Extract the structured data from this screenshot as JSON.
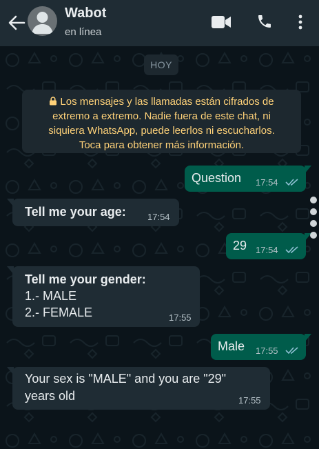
{
  "header": {
    "contact_name": "Wabot",
    "status": "en línea"
  },
  "colors": {
    "header_bg": "#1f2c34",
    "chat_bg": "#0b141a",
    "outgoing_bubble": "#005c4b",
    "incoming_bubble": "#1f2c34",
    "notice_text": "#ffd279",
    "read_ticks": "#8fc1d4"
  },
  "icons": {
    "back": "arrow-left-icon",
    "video": "video-camera-icon",
    "call": "phone-icon",
    "menu": "more-vertical-icon",
    "lock": "lock-icon",
    "read": "double-check-icon"
  },
  "chat": {
    "date_chip": "HOY",
    "encryption_notice": {
      "line1": "Los mensajes y las llamadas están cifrados de",
      "line2": "extremo a extremo. Nadie fuera de este chat, ni",
      "line3": "siquiera WhatsApp, puede leerlos ni escucharlos.",
      "line4": "Toca para obtener más información."
    },
    "messages": [
      {
        "direction": "out",
        "text": "Question",
        "time": "17:54",
        "status": "read"
      },
      {
        "direction": "in",
        "text": "Tell me your age:",
        "time": "17:54"
      },
      {
        "direction": "out",
        "text": "29",
        "time": "17:54",
        "status": "read"
      },
      {
        "direction": "in",
        "title": "Tell me your gender:",
        "line1": "1.- MALE",
        "line2": "2.- FEMALE",
        "time": "17:55"
      },
      {
        "direction": "out",
        "text": "Male",
        "time": "17:55",
        "status": "read"
      },
      {
        "direction": "in",
        "line1": "Your sex is \"MALE\" and you are \"29\"",
        "line2": "years old",
        "time": "17:55"
      }
    ]
  }
}
